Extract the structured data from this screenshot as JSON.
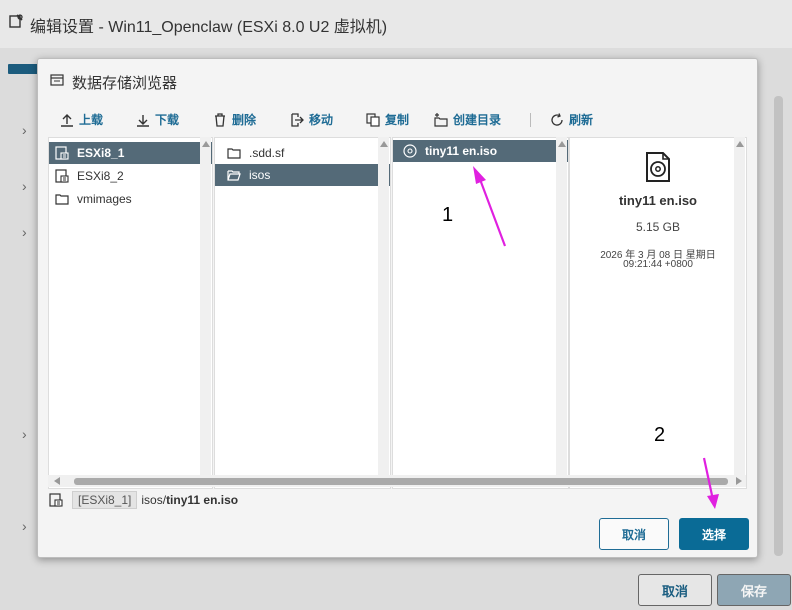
{
  "window": {
    "title": "编辑设置 - Win11_Openclaw (ESXi 8.0 U2 虚拟机)"
  },
  "background_buttons": {
    "cancel": "取消",
    "save": "保存"
  },
  "dialog": {
    "title": "数据存储浏览器",
    "toolbar": {
      "upload": "上载",
      "download": "下载",
      "delete": "删除",
      "move": "移动",
      "copy": "复制",
      "create_dir": "创建目录",
      "refresh": "刷新"
    },
    "datastores": [
      {
        "name": "ESXi8_1",
        "icon": "datastore-icon",
        "selected": true
      },
      {
        "name": "ESXi8_2",
        "icon": "datastore-icon",
        "selected": false
      },
      {
        "name": "vmimages",
        "icon": "folder-icon",
        "selected": false
      }
    ],
    "folders": [
      {
        "name": ".sdd.sf",
        "icon": "folder-icon",
        "selected": false
      },
      {
        "name": "isos",
        "icon": "folder-open-icon",
        "selected": true
      }
    ],
    "files": [
      {
        "name": "tiny11 en.iso",
        "icon": "disc-icon",
        "selected": true
      }
    ],
    "detail": {
      "name": "tiny11 en.iso",
      "size": "5.15 GB",
      "date": "2026 年 3 月 08 日 星期日",
      "time": "09:21:44 +0800"
    },
    "path": {
      "datastore": "[ESXi8_1]",
      "dir": "isos/",
      "file": "tiny11 en.iso"
    },
    "buttons": {
      "cancel": "取消",
      "select": "选择"
    }
  },
  "annotations": {
    "label1": "1",
    "label2": "2",
    "color": "#e020e0"
  }
}
